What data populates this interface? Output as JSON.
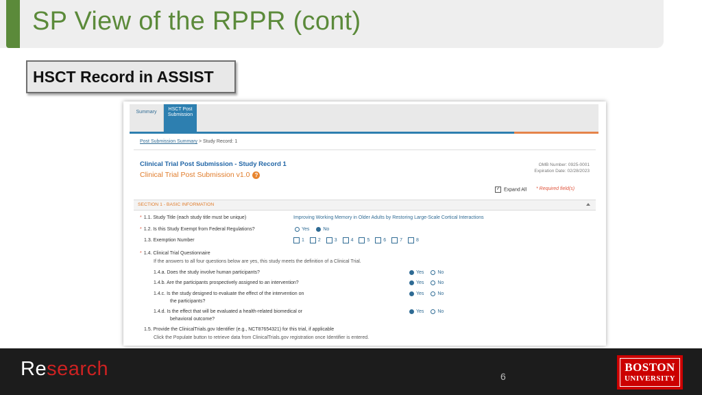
{
  "slide": {
    "title": "SP View of the RPPR (cont)",
    "subtitle": "HSCT Record in ASSIST",
    "page_number": "6",
    "brand_part1": "Re",
    "brand_part2": "search",
    "logo_line1": "BOSTON",
    "logo_line2": "UNIVERSITY"
  },
  "screenshot": {
    "tabs": [
      {
        "label": "Summary"
      },
      {
        "label_line1": "HSCT Post",
        "label_line2": "Submission"
      }
    ],
    "breadcrumb": {
      "link": "Post Submission Summary",
      "rest": "> Study Record: 1"
    },
    "record_title": "Clinical Trial Post Submission - Study Record 1",
    "record_version": "Clinical Trial Post Submission v1.0",
    "help_glyph": "?",
    "omb_number": "OMB Number: 0925-0001",
    "expiration": "Expiration Date: 02/28/2023",
    "expand_all": "Expand All",
    "required_note": "* Required field(s)",
    "section_title": "SECTION 1 - BASIC INFORMATION",
    "questions": {
      "q11_label": "1.1. Study Title (each study title must be unique)",
      "q11_answer": "Improving Working Memory in Older Adults by Restoring Large-Scale Cortical Interactions",
      "q12_label": "1.2. Is this Study Exempt from Federal Regulations?",
      "q13_label": "1.3. Exemption Number",
      "exemption_numbers": [
        "1",
        "2",
        "3",
        "4",
        "5",
        "6",
        "7",
        "8"
      ],
      "q14_label": "1.4. Clinical Trial Questionnaire",
      "q14_note": "If the answers to all four questions below are yes, this study meets the definition of a Clinical Trial.",
      "q14a": "1.4.a. Does the study involve human participants?",
      "q14b": "1.4.b. Are the participants prospectively assigned to an intervention?",
      "q14c_line1": "1.4.c. Is the study designed to evaluate the effect of the intervention on",
      "q14c_line2": "the participants?",
      "q14d_line1": "1.4.d. Is the effect that will be evaluated a health-related biomedical or",
      "q14d_line2": "behavioral outcome?",
      "q15_label": "1.5. Provide the ClinicalTrials.gov Identifier (e.g., NCT87654321) for this trial, if applicable",
      "q15_note": "Click the Populate button to retrieve data from ClinicalTrials.gov registration once Identifier is entered.",
      "yes": "Yes",
      "no": "No",
      "star": "*"
    }
  }
}
